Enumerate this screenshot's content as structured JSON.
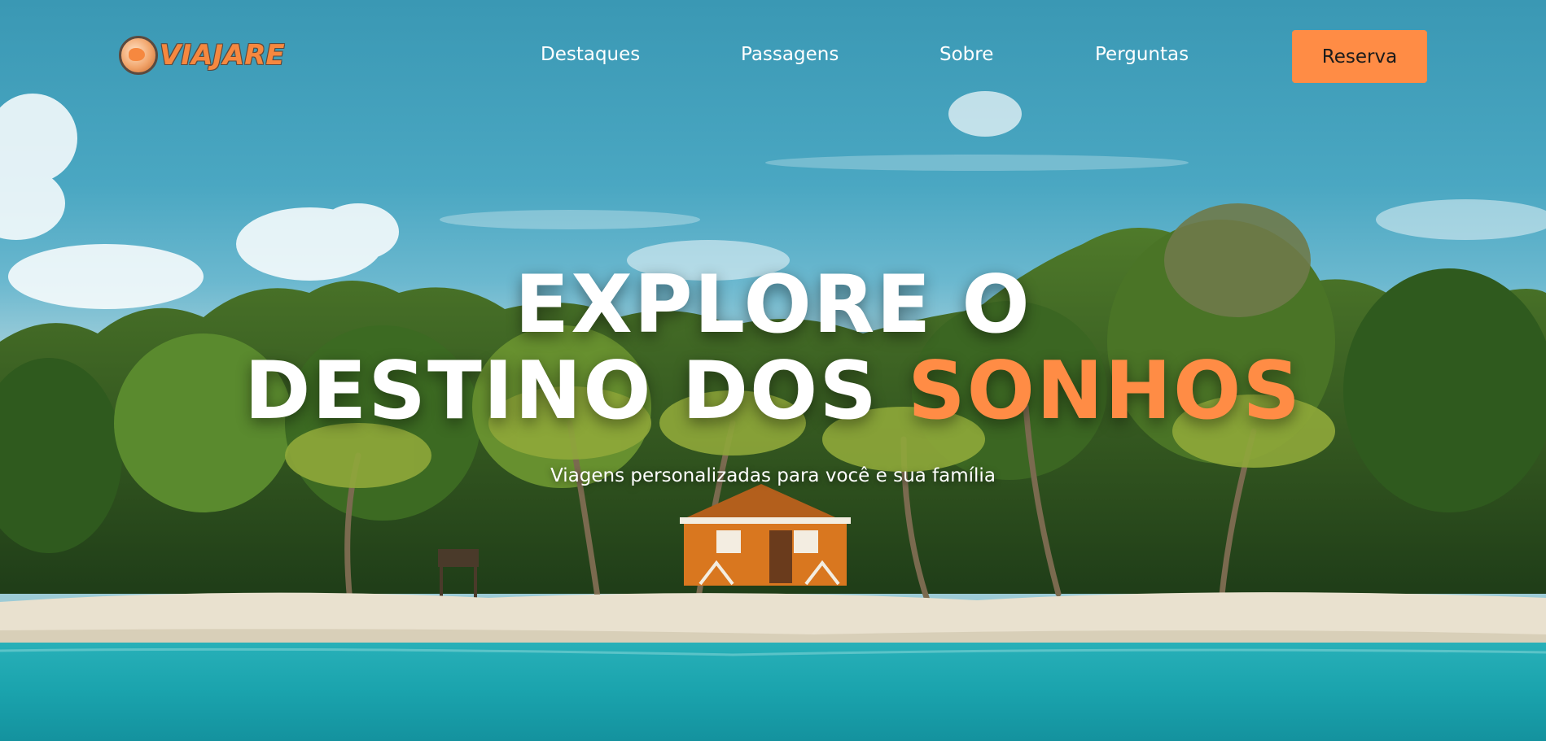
{
  "brand": {
    "name": "VIAJARE",
    "icon": "globe-logo-icon"
  },
  "nav": {
    "links": [
      {
        "label": "Destaques"
      },
      {
        "label": "Passagens"
      },
      {
        "label": "Sobre"
      },
      {
        "label": "Perguntas"
      }
    ],
    "cta_label": "Reserva"
  },
  "hero": {
    "line1": "EXPLORE O",
    "line2_main": "DESTINO DOS",
    "line2_accent": "SONHOS",
    "subtitle": "Viagens personalizadas para você e sua família"
  },
  "colors": {
    "accent": "#ff8c45",
    "text": "#ffffff",
    "sea": "#1fa7b5",
    "sky": "#4aa7c2"
  }
}
